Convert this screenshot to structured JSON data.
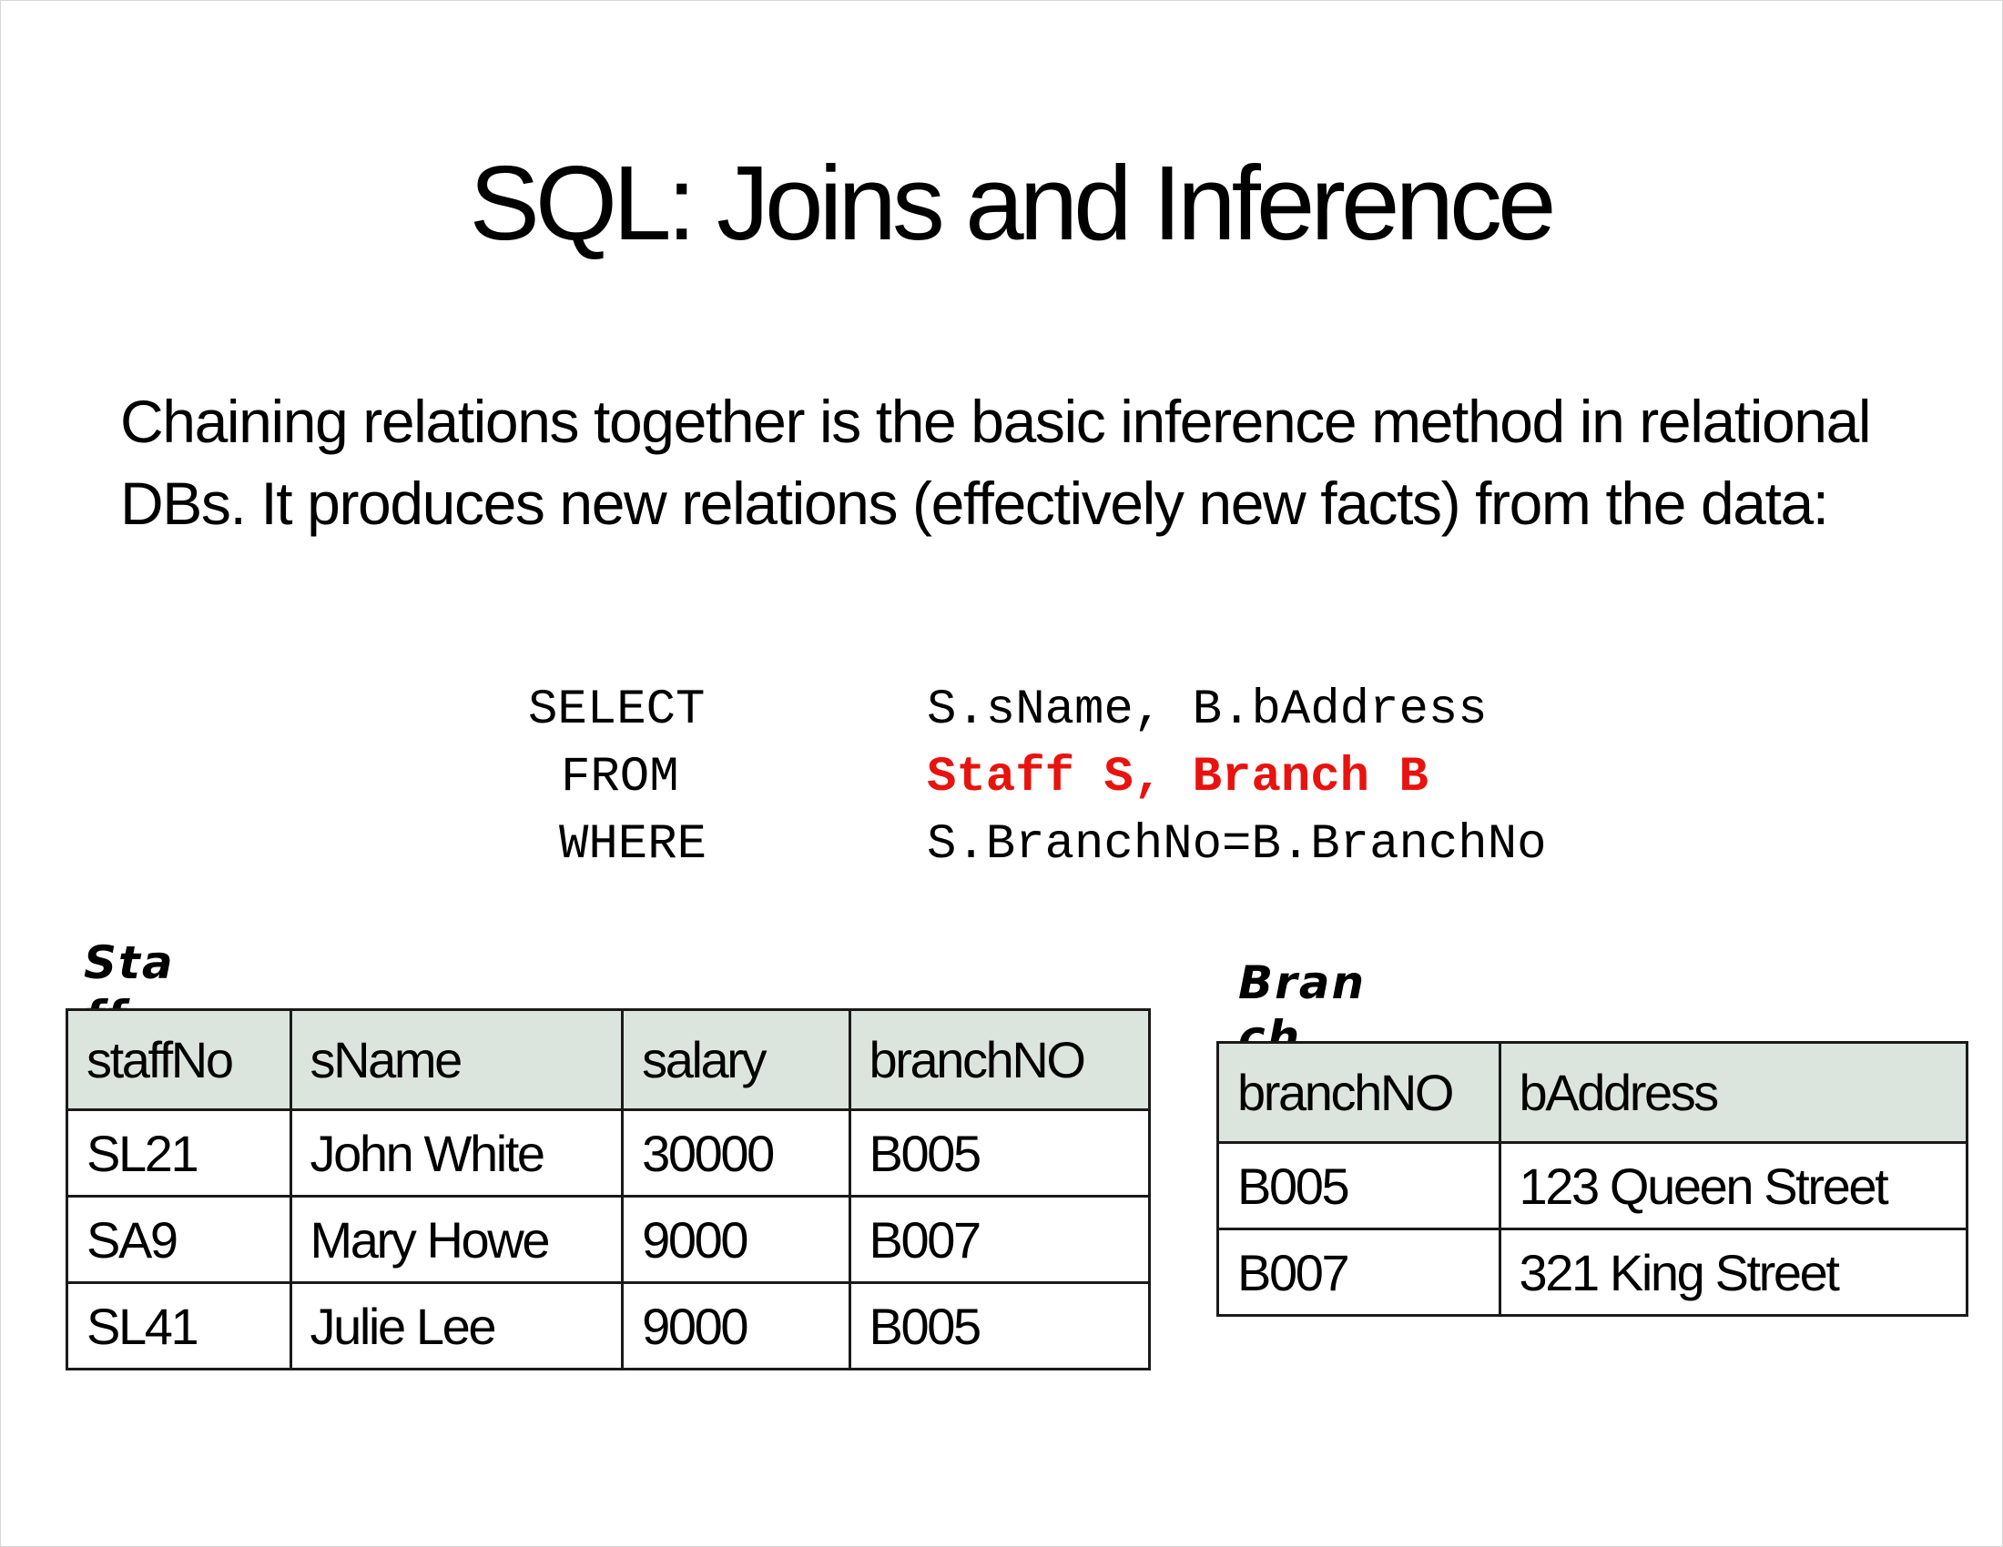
{
  "slide": {
    "title": "SQL: Joins and Inference",
    "paragraph": "Chaining relations together is the basic inference method in relational DBs. It produces new relations (effectively new facts) from the data:"
  },
  "sql": {
    "select_kw": "SELECT",
    "select_clause": "S.sName, B.bAddress",
    "from_kw": "FROM",
    "from_clause": "Staff S, Branch B",
    "where_kw": "WHERE",
    "where_clause": "S.BranchNo=B.BranchNo",
    "highlight_color": "#e8130e"
  },
  "staff_table": {
    "label": "Staff",
    "headers": [
      "staffNo",
      "sName",
      "salary",
      "branchNO"
    ],
    "rows": [
      [
        "SL21",
        "John White",
        "30000",
        "B005"
      ],
      [
        "SA9",
        "Mary Howe",
        "9000",
        "B007"
      ],
      [
        "SL41",
        "Julie Lee",
        "9000",
        "B005"
      ]
    ]
  },
  "branch_table": {
    "label": "Branch",
    "headers": [
      "branchNO",
      "bAddress"
    ],
    "rows": [
      [
        "B005",
        "123 Queen Street"
      ],
      [
        "B007",
        "321 King Street"
      ]
    ]
  },
  "colors": {
    "header_fill": "#dbe5de"
  }
}
